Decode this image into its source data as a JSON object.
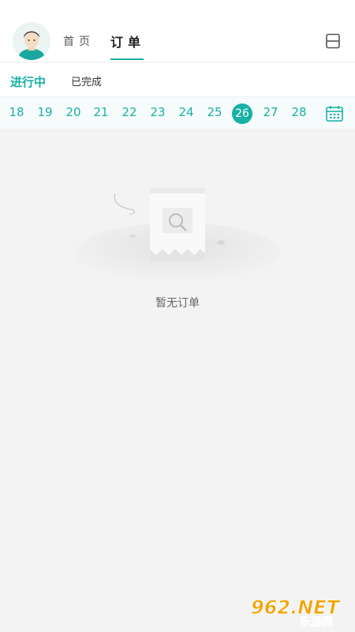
{
  "header": {
    "nav_home": "首页",
    "nav_orders": "订单",
    "avatar_icon": "user-avatar",
    "scan_icon": "scan-icon"
  },
  "subtabs": {
    "active": "进行中",
    "inactive": "已完成"
  },
  "dates": {
    "items": [
      "18",
      "19",
      "20",
      "21",
      "22",
      "23",
      "24",
      "25",
      "26",
      "27",
      "28"
    ],
    "selected": "26",
    "calendar_icon": "calendar-icon"
  },
  "empty": {
    "text": "暂无订单",
    "icon": "empty-receipt-illustration"
  },
  "watermark": {
    "brand": "962.NET",
    "subtitle": "乐游网"
  },
  "colors": {
    "accent": "#17b0a5",
    "background": "#f3f3f3"
  }
}
